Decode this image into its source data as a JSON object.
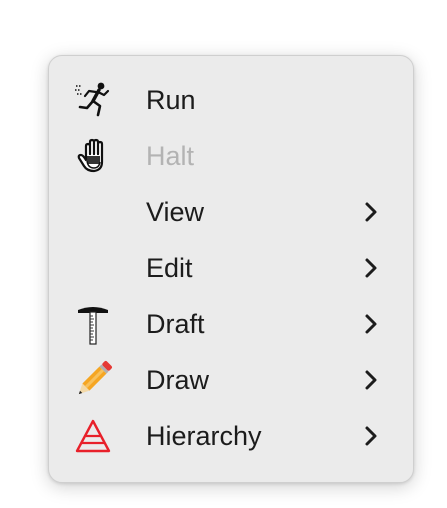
{
  "menu": {
    "items": [
      {
        "label": "Run",
        "icon": "running-man-icon",
        "enabled": true,
        "submenu": false
      },
      {
        "label": "Halt",
        "icon": "stop-hand-icon",
        "enabled": false,
        "submenu": false
      },
      {
        "label": "View",
        "icon": "",
        "enabled": true,
        "submenu": true
      },
      {
        "label": "Edit",
        "icon": "",
        "enabled": true,
        "submenu": true
      },
      {
        "label": "Draft",
        "icon": "t-square-icon",
        "enabled": true,
        "submenu": true
      },
      {
        "label": "Draw",
        "icon": "pencil-icon",
        "enabled": true,
        "submenu": true
      },
      {
        "label": "Hierarchy",
        "icon": "triangle-hierarchy-icon",
        "enabled": true,
        "submenu": true
      }
    ]
  },
  "colors": {
    "menu_background": "#ebebeb",
    "text": "#1c1c1c",
    "disabled_text": "#b3b3b3",
    "hierarchy_red": "#e8202a",
    "pencil_orange": "#f5a623"
  }
}
